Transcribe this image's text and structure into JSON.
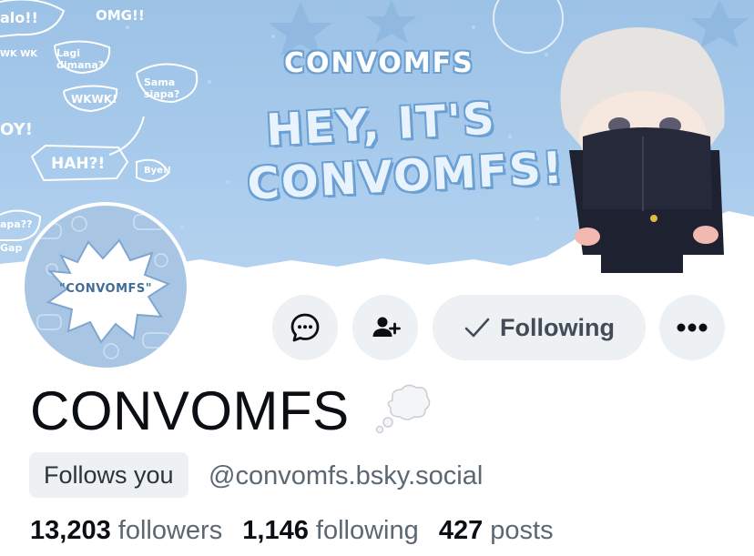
{
  "banner": {
    "small_title": "CONVOMFS",
    "big_title_line1": "HEY, IT'S",
    "big_title_line2": "CONVOMFS!",
    "doodles": [
      "alo!!",
      "OMG!!",
      "Lagi dimana?",
      "WK WK",
      "Sama siapa?",
      "WKWK!",
      "OY!",
      "HAH?!",
      "Bye!!",
      "apa??",
      "Gap"
    ],
    "colors": {
      "sky": "#a9cbec",
      "accent": "#6aa0d4"
    }
  },
  "avatar": {
    "label": "\"CONVOMFS\""
  },
  "actions": {
    "message_icon": "chat-bubble-icon",
    "follow_icon": "person-add-icon",
    "following_label": "Following",
    "following_icon": "check-icon",
    "more_icon": "ellipsis-icon"
  },
  "profile": {
    "display_name": "CONVOMFS",
    "name_emoji": "thought-balloon-icon",
    "follows_you": "Follows you",
    "handle": "@convomfs.bsky.social"
  },
  "stats": {
    "followers_count": "13,203",
    "followers_label": "followers",
    "following_count": "1,146",
    "following_label": "following",
    "posts_count": "427",
    "posts_label": "posts"
  }
}
